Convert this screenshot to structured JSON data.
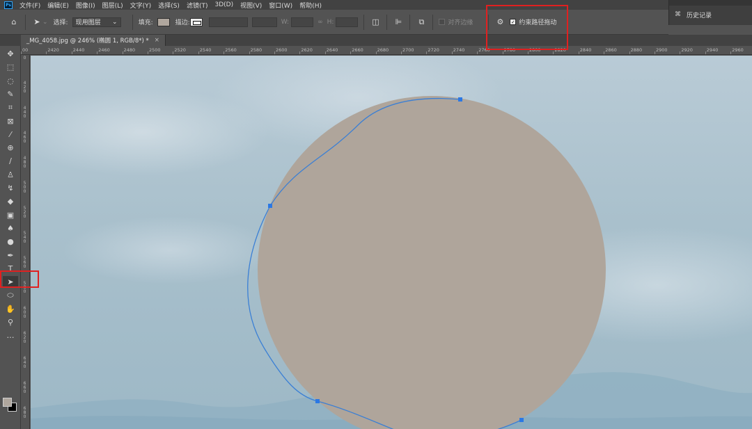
{
  "app": {
    "logo": "Ps"
  },
  "menu": [
    "文件(F)",
    "编辑(E)",
    "图像(I)",
    "图层(L)",
    "文字(Y)",
    "选择(S)",
    "滤镜(T)",
    "3D(D)",
    "视图(V)",
    "窗口(W)",
    "帮助(H)"
  ],
  "options": {
    "select_label": "选择:",
    "select_value": "现用图层",
    "fill_label": "填充:",
    "fill_color": "#b0a79e",
    "stroke_label": "描边:",
    "w_label": "W:",
    "h_label": "H:",
    "align_edges_label": "对齐边缘",
    "constrain_label": "约束路径拖动",
    "constrain_checked": true
  },
  "history_panel": {
    "title": "历史记录"
  },
  "document": {
    "tab_title": "_MG_4058.jpg @ 246% (椭圆 1, RGB/8*) *",
    "close": "×"
  },
  "ruler": {
    "h_ticks": [
      "00",
      "2420",
      "2440",
      "2460",
      "2480",
      "2500",
      "2520",
      "2540",
      "2560",
      "2580",
      "2600",
      "2620",
      "2640",
      "2660",
      "2680",
      "2700",
      "2720",
      "2740",
      "2760",
      "2780",
      "2800",
      "2820",
      "2840",
      "2860",
      "2880",
      "2900",
      "2920",
      "2940",
      "2960"
    ],
    "v_labels": [
      "0",
      "4 2 0",
      "4 4 0",
      "4 6 0",
      "4 8 0",
      "5 0 0",
      "5 2 0",
      "5 4 0",
      "5 6 0",
      "5 8 0",
      "6 0 0",
      "6 2 0",
      "6 4 0",
      "6 6 0",
      "6 8 0",
      "7 0 0"
    ]
  },
  "tools": [
    {
      "name": "move-tool",
      "glyph": "✥"
    },
    {
      "name": "marquee-tool",
      "glyph": "⬚"
    },
    {
      "name": "lasso-tool",
      "glyph": "◌"
    },
    {
      "name": "quick-select-tool",
      "glyph": "✎"
    },
    {
      "name": "crop-tool",
      "glyph": "⌗"
    },
    {
      "name": "frame-tool",
      "glyph": "⊠"
    },
    {
      "name": "eyedropper-tool",
      "glyph": "⁄"
    },
    {
      "name": "healing-brush-tool",
      "glyph": "⊕"
    },
    {
      "name": "brush-tool",
      "glyph": "∕"
    },
    {
      "name": "clone-stamp-tool",
      "glyph": "♙"
    },
    {
      "name": "history-brush-tool",
      "glyph": "↯"
    },
    {
      "name": "eraser-tool",
      "glyph": "◆"
    },
    {
      "name": "gradient-tool",
      "glyph": "▣"
    },
    {
      "name": "blur-tool",
      "glyph": "♠"
    },
    {
      "name": "dodge-tool",
      "glyph": "●"
    },
    {
      "name": "pen-tool",
      "glyph": "✒"
    },
    {
      "name": "type-tool",
      "glyph": "T"
    },
    {
      "name": "direct-selection-tool",
      "glyph": "➤"
    },
    {
      "name": "ellipse-tool",
      "glyph": "⬭"
    },
    {
      "name": "hand-tool",
      "glyph": "✋"
    },
    {
      "name": "zoom-tool",
      "glyph": "⚲"
    },
    {
      "name": "more-tools",
      "glyph": "…"
    }
  ],
  "colors": {
    "foreground": "#b0a79e",
    "background": "#000000",
    "shape_fill": "#afa59b",
    "path_stroke": "#3a7fd5",
    "annotation": "#e02020"
  }
}
